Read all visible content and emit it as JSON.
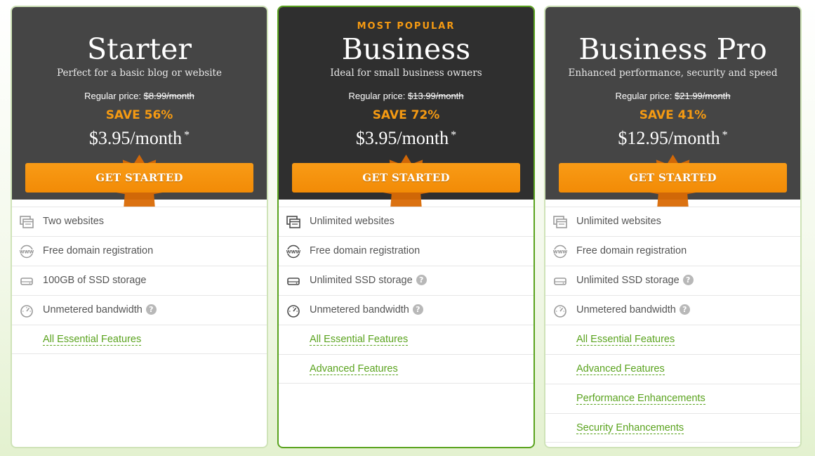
{
  "colors": {
    "accent_orange": "#f59a12",
    "cta_orange": "#f99b16",
    "link_green": "#5aa31e",
    "header_dark": "#454545",
    "header_darker": "#2f2f2f"
  },
  "plans": [
    {
      "badge": "",
      "name": "Starter",
      "description": "Perfect for a basic blog or website",
      "regular_label": "Regular price:",
      "regular_price": "$8.99/month",
      "save": "SAVE 56%",
      "price": "$3.95/month",
      "asterisk": "*",
      "cta": "GET STARTED",
      "features": [
        {
          "icon": "websites-icon",
          "text": "Two websites",
          "help": ""
        },
        {
          "icon": "www-icon",
          "text": "Free domain registration",
          "help": ""
        },
        {
          "icon": "ssd-drive-icon",
          "text": "100GB of SSD storage",
          "help": ""
        },
        {
          "icon": "speedometer-icon",
          "text": "Unmetered bandwidth",
          "help": "?"
        }
      ],
      "links": [
        "All Essential Features"
      ]
    },
    {
      "badge": "MOST POPULAR",
      "name": "Business",
      "description": "Ideal for small business owners",
      "regular_label": "Regular price:",
      "regular_price": "$13.99/month",
      "save": "SAVE 72%",
      "price": "$3.95/month",
      "asterisk": "*",
      "cta": "GET STARTED",
      "features": [
        {
          "icon": "websites-icon",
          "text": "Unlimited websites",
          "help": ""
        },
        {
          "icon": "www-icon",
          "text": "Free domain registration",
          "help": ""
        },
        {
          "icon": "ssd-drive-icon",
          "text": "Unlimited SSD storage",
          "help": "?"
        },
        {
          "icon": "speedometer-icon",
          "text": "Unmetered bandwidth",
          "help": "?"
        }
      ],
      "links": [
        "All Essential Features",
        "Advanced Features"
      ]
    },
    {
      "badge": "",
      "name": "Business Pro",
      "description": "Enhanced performance, security and speed",
      "regular_label": "Regular price:",
      "regular_price": "$21.99/month",
      "save": "SAVE 41%",
      "price": "$12.95/month",
      "asterisk": "*",
      "cta": "GET STARTED",
      "features": [
        {
          "icon": "websites-icon",
          "text": "Unlimited websites",
          "help": ""
        },
        {
          "icon": "www-icon",
          "text": "Free domain registration",
          "help": ""
        },
        {
          "icon": "ssd-drive-icon",
          "text": "Unlimited SSD storage",
          "help": "?"
        },
        {
          "icon": "speedometer-icon",
          "text": "Unmetered bandwidth",
          "help": "?"
        }
      ],
      "links": [
        "All Essential Features",
        "Advanced Features",
        "Performance Enhancements",
        "Security Enhancements"
      ]
    }
  ]
}
